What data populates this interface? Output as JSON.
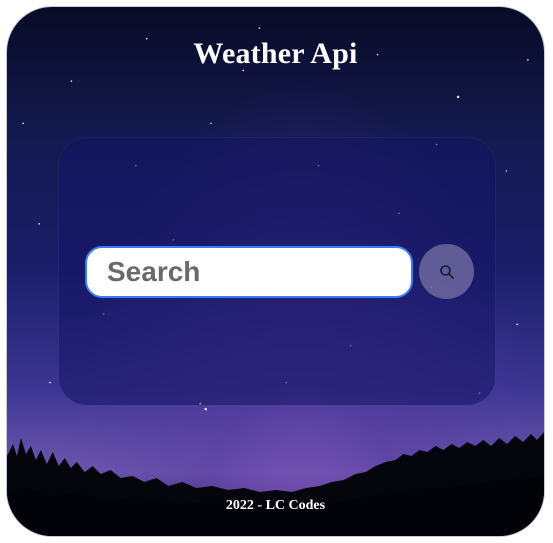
{
  "header": {
    "title": "Weather Api"
  },
  "search": {
    "placeholder": "Search",
    "value": "",
    "button_icon": "search-icon"
  },
  "footer": {
    "text": "2022 - LC Codes"
  },
  "colors": {
    "input_border": "#3e7bf0",
    "search_button_bg": "#7873a5",
    "card_bg": "#141464"
  }
}
